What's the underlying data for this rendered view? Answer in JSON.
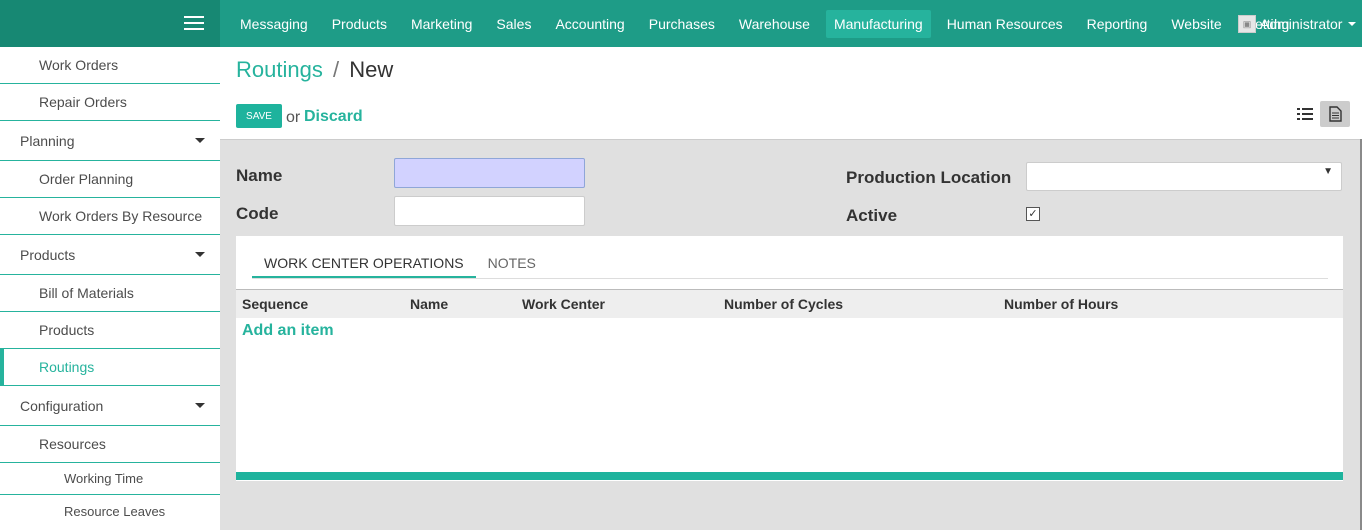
{
  "topbar": {
    "menu": [
      {
        "label": "Messaging",
        "active": false
      },
      {
        "label": "Products",
        "active": false
      },
      {
        "label": "Marketing",
        "active": false
      },
      {
        "label": "Sales",
        "active": false
      },
      {
        "label": "Accounting",
        "active": false
      },
      {
        "label": "Purchases",
        "active": false
      },
      {
        "label": "Warehouse",
        "active": false
      },
      {
        "label": "Manufacturing",
        "active": true
      },
      {
        "label": "Human Resources",
        "active": false
      },
      {
        "label": "Reporting",
        "active": false
      },
      {
        "label": "Website",
        "active": false
      },
      {
        "label": "Setting",
        "active": false
      }
    ],
    "user": "Administrator"
  },
  "sidebar": {
    "items": [
      {
        "label": "Work Orders",
        "level": 2
      },
      {
        "label": "Repair Orders",
        "level": 2
      },
      {
        "label": "Planning",
        "level": 1
      },
      {
        "label": "Order Planning",
        "level": 2
      },
      {
        "label": "Work Orders By Resource",
        "level": 2
      },
      {
        "label": "Products",
        "level": 1
      },
      {
        "label": "Bill of Materials",
        "level": 2
      },
      {
        "label": "Products",
        "level": 2
      },
      {
        "label": "Routings",
        "level": 2,
        "active": true
      },
      {
        "label": "Configuration",
        "level": 1
      },
      {
        "label": "Resources",
        "level": 2
      },
      {
        "label": "Working Time",
        "level": 3
      },
      {
        "label": "Resource Leaves",
        "level": 3
      }
    ]
  },
  "breadcrumb": {
    "parent": "Routings",
    "separator": "/",
    "current": "New"
  },
  "actions": {
    "save": "SAVE",
    "or": "or",
    "discard": "Discard"
  },
  "form": {
    "name_label": "Name",
    "name_value": "",
    "code_label": "Code",
    "code_value": "",
    "production_location_label": "Production Location",
    "production_location_value": "",
    "active_label": "Active",
    "active_checked": true
  },
  "tabs": [
    {
      "label": "WORK CENTER OPERATIONS",
      "active": true
    },
    {
      "label": "NOTES",
      "active": false
    }
  ],
  "table": {
    "columns": [
      "Sequence",
      "Name",
      "Work Center",
      "Number of Cycles",
      "Number of Hours"
    ],
    "add_item": "Add an item"
  },
  "colors": {
    "brand": "#1e9c87",
    "accent": "#26b39d"
  }
}
